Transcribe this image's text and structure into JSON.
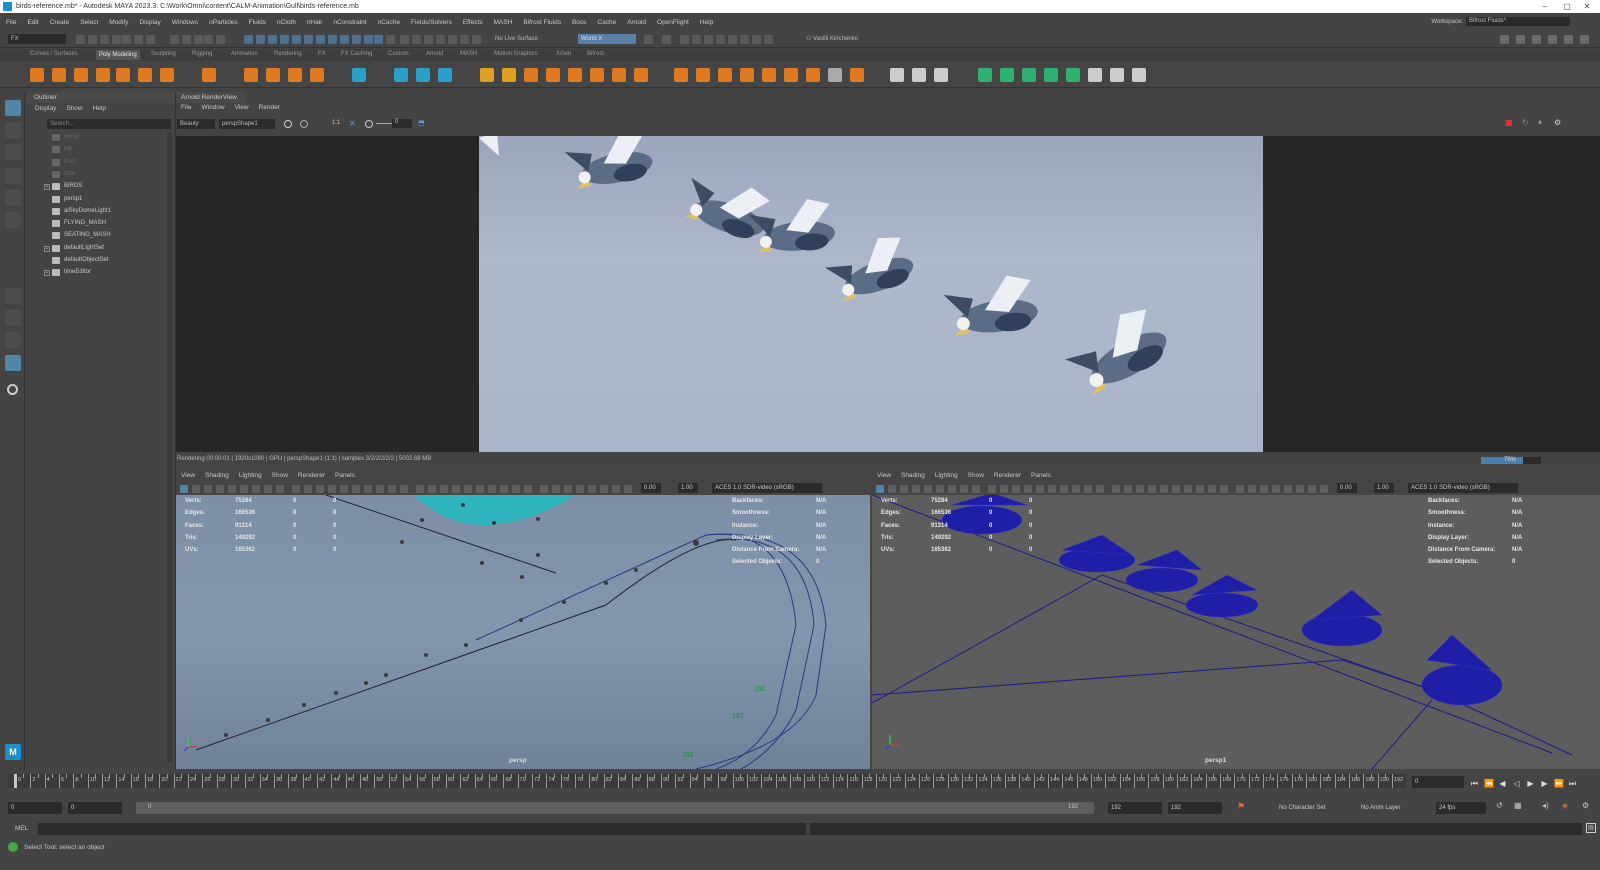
{
  "window": {
    "title": "birds-reference.mb* - Autodesk MAYA 2023.3: C:\\Work\\Omni\\content\\CALM-Animation\\Gull\\birds-reference.mb",
    "minimize": "–",
    "maximize": "▢",
    "close": "✕"
  },
  "menubar": {
    "items": [
      "File",
      "Edit",
      "Create",
      "Select",
      "Modify",
      "Display",
      "Windows",
      "nParticles",
      "Fluids",
      "nCloth",
      "nHair",
      "nConstraint",
      "nCache",
      "Fields/Solvers",
      "Effects",
      "MASH",
      "Bifrost Fluids",
      "Boss",
      "Cache",
      "Arnold",
      "OpenFlight",
      "Help"
    ],
    "workspace_label": "Workspace:",
    "workspace_value": "Bifrost Fluids*"
  },
  "statusline": {
    "menuset": "FX",
    "live_surface": "No Live Surface",
    "space": "World X",
    "user": "Vasilii Kirichenko"
  },
  "shelf": {
    "tabs": [
      "Curves / Surfaces",
      "Poly Modeling",
      "Sculpting",
      "Rigging",
      "Animation",
      "Rendering",
      "FX",
      "FX Caching",
      "Custom",
      "Arnold",
      "MASH",
      "Motion Graphics",
      "XGen",
      "Bifrost"
    ],
    "active_tab": "Poly Modeling"
  },
  "outliner": {
    "title": "Outliner",
    "menu": [
      "Display",
      "Show",
      "Help"
    ],
    "search_placeholder": "Search...",
    "items": [
      {
        "label": "persp",
        "dim": true,
        "expand": false
      },
      {
        "label": "top",
        "dim": true,
        "expand": false
      },
      {
        "label": "front",
        "dim": true,
        "expand": false
      },
      {
        "label": "side",
        "dim": true,
        "expand": false
      },
      {
        "label": "BIRDS",
        "dim": false,
        "expand": true
      },
      {
        "label": "persp1",
        "dim": false,
        "expand": false
      },
      {
        "label": "aiSkyDomeLight1",
        "dim": false,
        "expand": false
      },
      {
        "label": "FLYING_MASH",
        "dim": false,
        "expand": false
      },
      {
        "label": "SEATING_MASH",
        "dim": false,
        "expand": false
      },
      {
        "label": "defaultLightSet",
        "dim": false,
        "expand": true
      },
      {
        "label": "defaultObjectSet",
        "dim": false,
        "expand": false
      },
      {
        "label": "timeEditor",
        "dim": false,
        "expand": true
      }
    ]
  },
  "renderview": {
    "title": "Arnold RenderView",
    "menu": [
      "File",
      "Window",
      "View",
      "Render"
    ],
    "aov": "Beauty",
    "camera": "perspShape1",
    "ratio": "1:1",
    "exposure": "0",
    "status": "Rendering 00:00:01 | 1920x1080 | GPU | perspShape1 (1:1) | samples 3/2/2/2/2/2 | 5002.68 MB",
    "progress_text": "75%",
    "progress": 0.7
  },
  "viewport_left": {
    "menu": [
      "View",
      "Shading",
      "Lighting",
      "Show",
      "Renderer",
      "Panels"
    ],
    "gamma": "0.00",
    "exposure": "1.00",
    "colorspace": "ACES 1.0 SDR-video (sRGB)",
    "camera_label": "persp",
    "hud_left": [
      [
        "Verts:",
        "75284",
        "0",
        "0"
      ],
      [
        "Edges:",
        "166536",
        "0",
        "0"
      ],
      [
        "Faces:",
        "91314",
        "0",
        "0"
      ],
      [
        "Tris:",
        "149292",
        "0",
        "0"
      ],
      [
        "UVs:",
        "165362",
        "0",
        "0"
      ]
    ],
    "hud_right": [
      [
        "Backfaces:",
        "N/A"
      ],
      [
        "Smoothness:",
        "N/A"
      ],
      [
        "Instance:",
        "N/A"
      ],
      [
        "Display Layer:",
        "N/A"
      ],
      [
        "Distance From Camera:",
        "N/A"
      ],
      [
        "Selected Objects:",
        "0"
      ]
    ],
    "curve_labels": [
      "192",
      "192",
      "192"
    ]
  },
  "viewport_right": {
    "menu": [
      "View",
      "Shading",
      "Lighting",
      "Show",
      "Renderer",
      "Panels"
    ],
    "gamma": "0.00",
    "exposure": "1.00",
    "colorspace": "ACES 1.0 SDR-video (sRGB)",
    "camera_label": "persp1",
    "hud_left": [
      [
        "Verts:",
        "75284",
        "0",
        "0"
      ],
      [
        "Edges:",
        "166536",
        "0",
        "0"
      ],
      [
        "Faces:",
        "91314",
        "0",
        "0"
      ],
      [
        "Tris:",
        "149292",
        "0",
        "0"
      ],
      [
        "UVs:",
        "165362",
        "0",
        "0"
      ]
    ],
    "hud_right": [
      [
        "Backfaces:",
        "N/A"
      ],
      [
        "Smoothness:",
        "N/A"
      ],
      [
        "Instance:",
        "N/A"
      ],
      [
        "Display Layer:",
        "N/A"
      ],
      [
        "Distance From Camera:",
        "N/A"
      ],
      [
        "Selected Objects:",
        "0"
      ]
    ]
  },
  "timeslider": {
    "start": 0,
    "end": 192,
    "current": "0",
    "tick_labels": [
      "0",
      "2",
      "4",
      "6",
      "8",
      "10",
      "12",
      "14",
      "16",
      "18",
      "20",
      "22",
      "24",
      "26",
      "28",
      "30",
      "32",
      "34",
      "36",
      "38",
      "40",
      "42",
      "44",
      "46",
      "48",
      "50",
      "52",
      "54",
      "56",
      "58",
      "60",
      "62",
      "64",
      "66",
      "68",
      "70",
      "72",
      "74",
      "76",
      "78",
      "80",
      "82",
      "84",
      "86",
      "88",
      "90",
      "92",
      "94",
      "96",
      "98",
      "100",
      "102",
      "104",
      "106",
      "108",
      "110",
      "112",
      "114",
      "116",
      "118",
      "120",
      "122",
      "124",
      "126",
      "128",
      "130",
      "132",
      "134",
      "136",
      "138",
      "140",
      "142",
      "144",
      "146",
      "148",
      "150",
      "152",
      "154",
      "156",
      "158",
      "160",
      "162",
      "164",
      "166",
      "168",
      "170",
      "172",
      "174",
      "176",
      "178",
      "180",
      "182",
      "184",
      "186",
      "188",
      "190",
      "192"
    ]
  },
  "rangeslider": {
    "start_field": "0",
    "start_field2": "0",
    "range_start": "0",
    "range_end": "192",
    "end_field": "192",
    "end_field2": "192",
    "character_set": "No Character Set",
    "anim_layer": "No Anim Layer",
    "fps": "24 fps"
  },
  "cmdline": {
    "label": "MEL"
  },
  "helpline": {
    "text": "Select Tool: select an object"
  }
}
